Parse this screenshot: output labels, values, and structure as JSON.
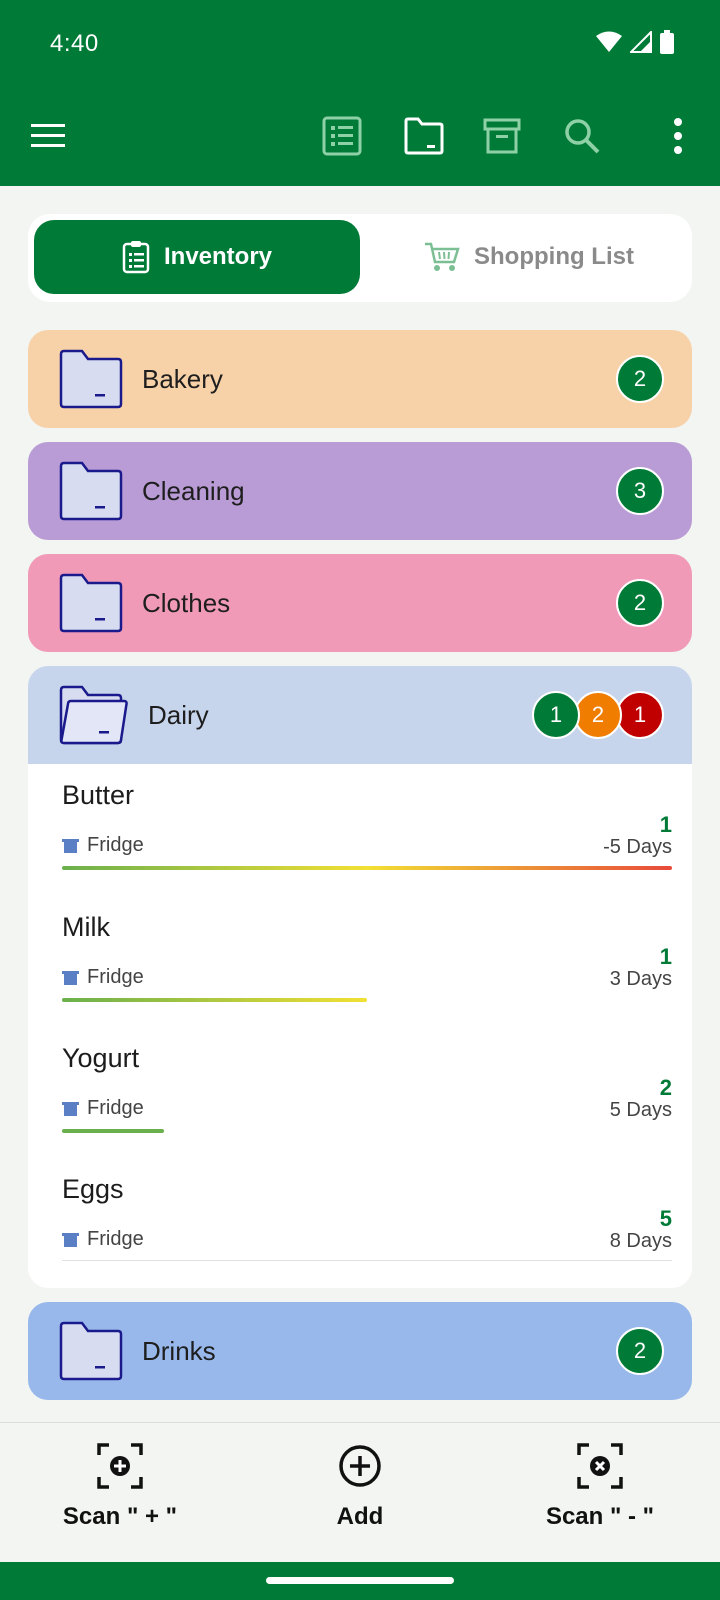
{
  "status": {
    "time": "4:40"
  },
  "toolbar": {
    "icons": [
      "menu-icon",
      "list-icon",
      "folder-icon",
      "archive-icon",
      "search-icon",
      "more-vert-icon"
    ],
    "accent": "#007a37"
  },
  "tabs": {
    "inventory": "Inventory",
    "shopping": "Shopping List"
  },
  "categories": [
    {
      "name": "Bakery",
      "count": "2",
      "color": "#f7d2a9"
    },
    {
      "name": "Cleaning",
      "count": "3",
      "color": "#b99bd6"
    },
    {
      "name": "Clothes",
      "count": "2",
      "color": "#f09ab8"
    },
    {
      "name": "Drinks",
      "count": "2",
      "color": "#98b8ec"
    }
  ],
  "dairy": {
    "name": "Dairy",
    "color": "#c7d5ec",
    "badges": [
      {
        "count": "1",
        "color": "#007a37"
      },
      {
        "count": "2",
        "color": "#f07c00"
      },
      {
        "count": "1",
        "color": "#c00000"
      }
    ],
    "items": [
      {
        "name": "Butter",
        "location": "Fridge",
        "quantity": "1",
        "days": "-5 Days",
        "freshness": 1.0
      },
      {
        "name": "Milk",
        "location": "Fridge",
        "quantity": "1",
        "days": "3 Days",
        "freshness": 0.5
      },
      {
        "name": "Yogurt",
        "location": "Fridge",
        "quantity": "2",
        "days": "5 Days",
        "freshness": 0.17
      },
      {
        "name": "Eggs",
        "location": "Fridge",
        "quantity": "5",
        "days": "8 Days",
        "freshness": 0
      }
    ]
  },
  "bottom": {
    "scan_plus": "Scan \" + \"",
    "add": "Add",
    "scan_minus": "Scan \" - \""
  }
}
